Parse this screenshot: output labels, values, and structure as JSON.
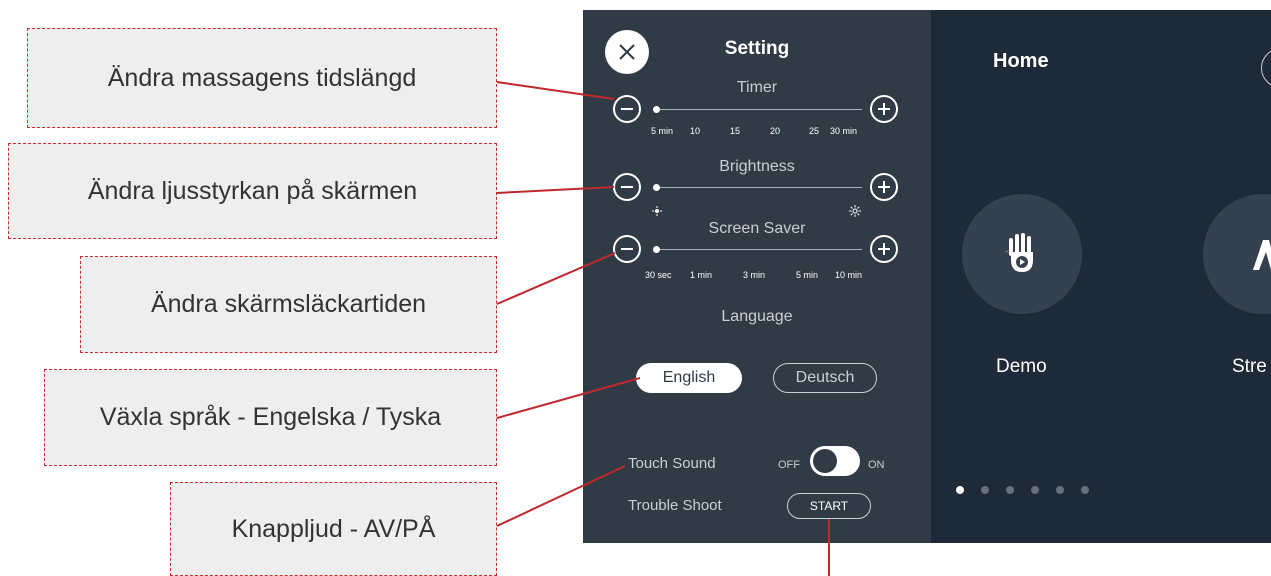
{
  "callouts": {
    "timer": "Ändra massagens tidslängd",
    "brightness": "Ändra ljusstyrkan på skärmen",
    "screen_saver": "Ändra skärmsläckartiden",
    "language": "Växla språk - Engelska / Tyska",
    "touch_sound": "Knappljud - AV/PÅ"
  },
  "settings": {
    "title": "Setting",
    "close_icon": "close-icon",
    "timer": {
      "label": "Timer",
      "ticks": [
        "5 min",
        "10",
        "15",
        "20",
        "25",
        "30 min"
      ],
      "selected": "5 min"
    },
    "brightness": {
      "label": "Brightness",
      "low_icon": "brightness-low-icon",
      "high_icon": "brightness-high-icon",
      "level": 0
    },
    "screen_saver": {
      "label": "Screen Saver",
      "ticks": [
        "30 sec",
        "1 min",
        "3 min",
        "5 min",
        "10 min"
      ],
      "selected": "30 sec"
    },
    "language": {
      "label": "Language",
      "options": [
        "English",
        "Deutsch"
      ],
      "selected": "English"
    },
    "touch_sound": {
      "label": "Touch Sound",
      "off_label": "OFF",
      "on_label": "ON",
      "state": "ON"
    },
    "trouble_shoot": {
      "label": "Trouble Shoot",
      "button": "START"
    }
  },
  "home": {
    "title": "Home",
    "tiles": [
      {
        "label": "Demo",
        "icon": "hand-play-icon"
      },
      {
        "label": "Stre",
        "icon": "stretch-icon"
      }
    ],
    "page_dots": 6,
    "active_dot": 1
  },
  "colors": {
    "settings_bg": "#313b46",
    "home_bg": "#1f2a38",
    "callout_border": "#cc2b2b",
    "callout_bg": "#eeeeee",
    "leader_line": "#c0282d"
  }
}
